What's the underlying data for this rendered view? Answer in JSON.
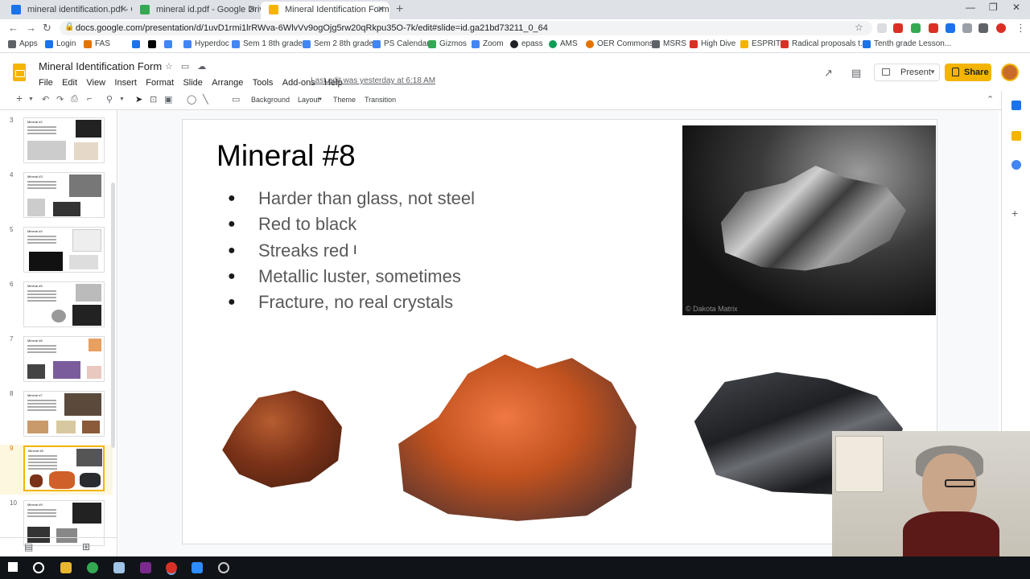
{
  "browser": {
    "tabs": [
      {
        "title": "mineral identification.pdf - Goog",
        "favicon_color": "#1a73e8"
      },
      {
        "title": "mineral id.pdf - Google Drive",
        "favicon_color": "#34a853"
      },
      {
        "title": "Mineral Identification Form - Goo",
        "favicon_color": "#f4b400"
      }
    ],
    "url": "docs.google.com/presentation/d/1uvD1rmi1lrRWva-6WlvVv9ogOjg5rw20qRkpu35O-7k/edit#slide=id.ga21bd73211_0_64",
    "bookmarks": [
      {
        "label": "Apps",
        "color": "#5f6368"
      },
      {
        "label": "Login",
        "color": "#1a73e8"
      },
      {
        "label": "FAS",
        "color": "#e37400"
      },
      {
        "label": "",
        "color": "#1a73e8"
      },
      {
        "label": "",
        "color": "#000000"
      },
      {
        "label": "",
        "color": "#4285f4"
      },
      {
        "label": "Hyperdoc",
        "color": "#4285f4"
      },
      {
        "label": "Sem 1 8th grade",
        "color": "#4285f4"
      },
      {
        "label": "Sem 2 8th grade",
        "color": "#4285f4"
      },
      {
        "label": "PS Calendar",
        "color": "#4285f4"
      },
      {
        "label": "Gizmos",
        "color": "#34a853"
      },
      {
        "label": "Zoom",
        "color": "#4285f4"
      },
      {
        "label": "epass",
        "color": "#202124"
      },
      {
        "label": "AMS",
        "color": "#0f9d58"
      },
      {
        "label": "OER Commons",
        "color": "#e37400"
      },
      {
        "label": "MSRS",
        "color": "#5f6368"
      },
      {
        "label": "High Dive",
        "color": "#d93025"
      },
      {
        "label": "ESPRIT",
        "color": "#f4b400"
      },
      {
        "label": "Radical proposals t...",
        "color": "#d93025"
      },
      {
        "label": "Tenth grade Lesson...",
        "color": "#1a73e8"
      }
    ]
  },
  "app": {
    "doc_title": "Mineral Identification Form",
    "menus": [
      "File",
      "Edit",
      "View",
      "Insert",
      "Format",
      "Slide",
      "Arrange",
      "Tools",
      "Add-ons",
      "Help"
    ],
    "last_edit": "Last edit was yesterday at 6:18 AM",
    "present_label": "Present",
    "share_label": "Share",
    "toolbar": {
      "background": "Background",
      "layout": "Layout",
      "theme": "Theme",
      "transition": "Transition"
    }
  },
  "filmstrip": [
    {
      "num": "3",
      "title": "Mineral #2"
    },
    {
      "num": "4",
      "title": "Mineral #3"
    },
    {
      "num": "5",
      "title": "Mineral #4"
    },
    {
      "num": "6",
      "title": "Mineral #5"
    },
    {
      "num": "7",
      "title": "Mineral #6"
    },
    {
      "num": "8",
      "title": "Mineral #7"
    },
    {
      "num": "9",
      "title": "Mineral #8",
      "active": true
    },
    {
      "num": "10",
      "title": "Mineral #9"
    }
  ],
  "slide": {
    "title": "Mineral #8",
    "bullets": [
      "Harder than glass, not steel",
      "Red to black",
      "Streaks red",
      "Metallic luster, sometimes",
      "Fracture, no real crystals"
    ],
    "watermark": "© Dakota Matrix"
  },
  "colors": {
    "accent": "#f4b400",
    "share": "#f4b400",
    "taskbar": "#101418"
  }
}
